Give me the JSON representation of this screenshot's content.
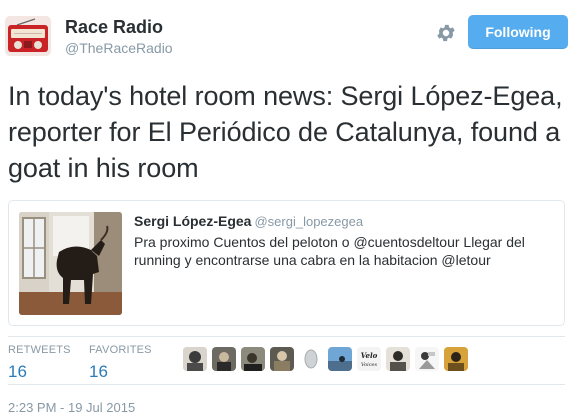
{
  "header": {
    "display_name": "Race Radio",
    "screen_name": "@TheRaceRadio",
    "follow_label": "Following",
    "avatar_icon": "radio-icon",
    "settings_icon": "gear-icon"
  },
  "tweet": {
    "text": "In today's hotel room news: Sergi López-Egea, reporter for El Periódico de Catalunya, found a goat in his room"
  },
  "quoted_tweet": {
    "name": "Sergi López-Egea",
    "handle": "@sergi_lopezegea",
    "text": "Pra proximo Cuentos del peloton o @cuentosdeltour Llegar del running y encontrarse una cabra en la habitacion @letour"
  },
  "stats": {
    "retweets_label": "RETWEETS",
    "retweets_count": "16",
    "favorites_label": "FAVORITES",
    "favorites_count": "16"
  },
  "favoriters_count_shown": 10,
  "timestamp": "2:23 PM - 19 Jul 2015",
  "colors": {
    "accent": "#55acee",
    "link": "#2b7bb9",
    "muted": "#8899a6",
    "border": "#e1e8ed",
    "text": "#292f33"
  }
}
